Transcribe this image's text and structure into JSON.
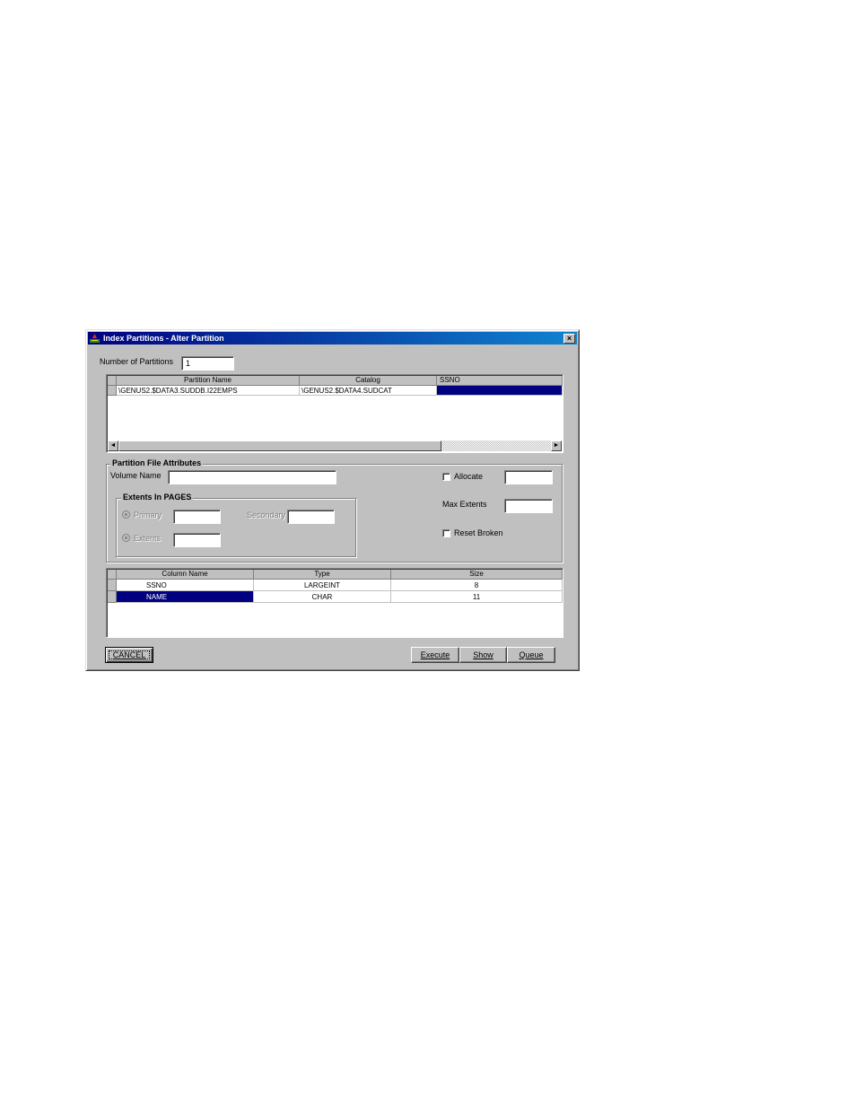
{
  "window": {
    "title": "Index Partitions - Alter Partition",
    "close_glyph": "×",
    "icon": "app-logo-icon"
  },
  "num_partitions": {
    "label": "Number of Partitions",
    "value": "1"
  },
  "partition_table": {
    "columns": [
      "Partition Name",
      "Catalog",
      "SSNO"
    ],
    "rows": [
      {
        "partition_name": "\\GENUS2.$DATA3.SUDDB.I22EMPS",
        "catalog": "\\GENUS2.$DATA4.SUDCAT",
        "ssno": ""
      }
    ],
    "scroll_left": "◄",
    "scroll_right": "►"
  },
  "attributes": {
    "group_title": "Partition File Attributes",
    "volume_name_label": "Volume Name",
    "volume_name_value": "",
    "allocate_label": "Allocate",
    "allocate_checked": false,
    "allocate_value": "",
    "max_extents_label": "Max Extents",
    "max_extents_value": "",
    "reset_broken_label": "Reset Broken",
    "reset_broken_checked": false,
    "extents_group": {
      "title": "Extents In PAGES",
      "primary_label": "Primary",
      "primary_value": "",
      "secondary_label": "Secondary",
      "secondary_value": "",
      "extents_label": "Extents",
      "extents_value": ""
    }
  },
  "column_table": {
    "columns": [
      "Column Name",
      "Type",
      "Size"
    ],
    "rows": [
      {
        "name": "SSNO",
        "type": "LARGEINT",
        "size": "8"
      },
      {
        "name": "NAME",
        "type": "CHAR",
        "size": "11"
      }
    ]
  },
  "buttons": {
    "cancel": "CANCEL",
    "execute": "Execute",
    "show": "Show",
    "queue": "Queue"
  },
  "colors": {
    "title_bar": "#000080",
    "selection": "#000080",
    "face": "#c0c0c0"
  }
}
